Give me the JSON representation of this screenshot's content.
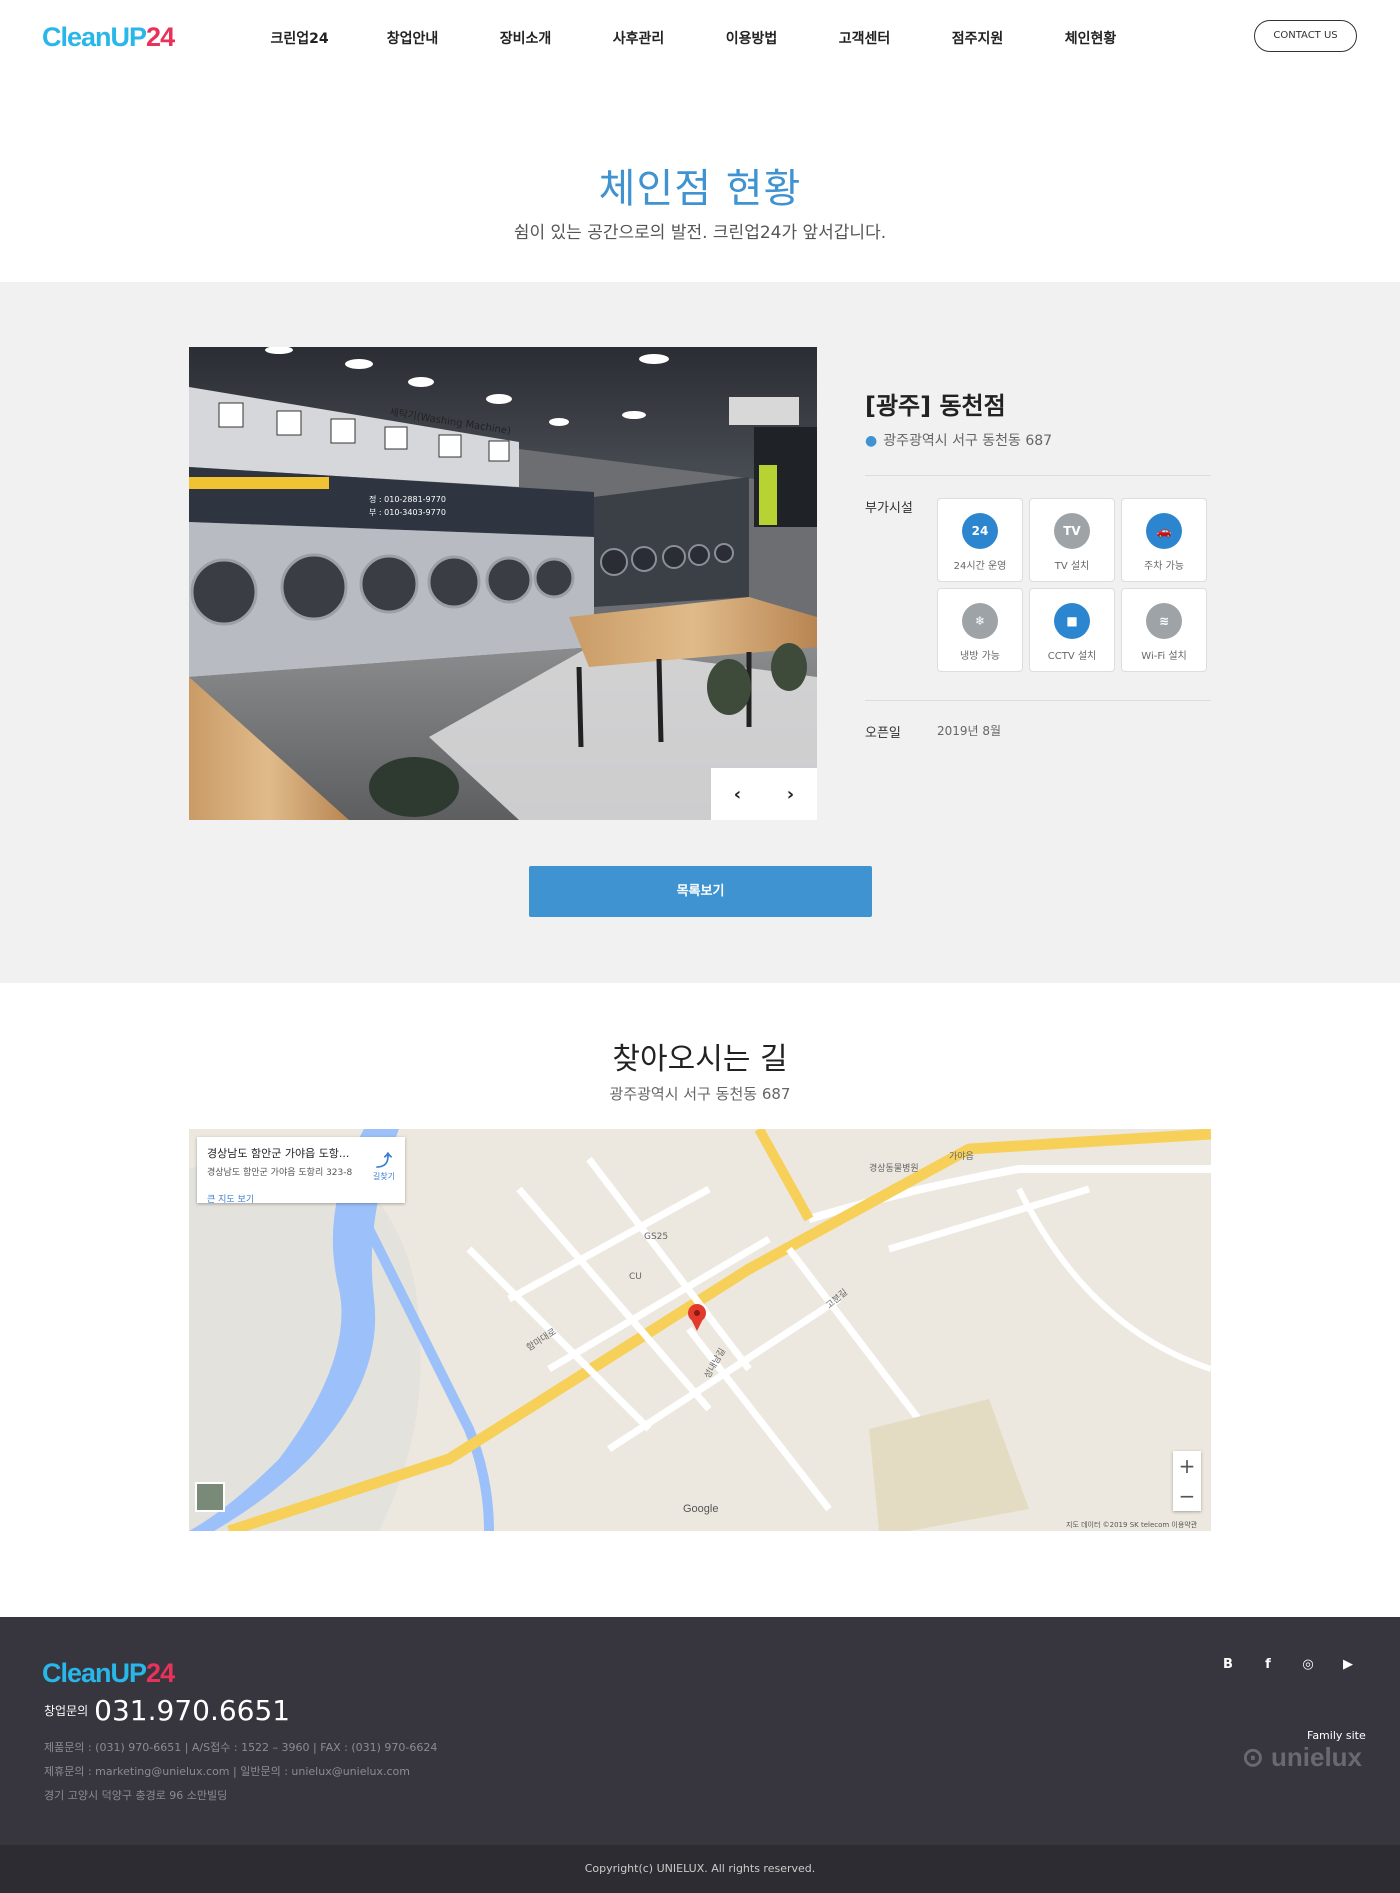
{
  "header": {
    "logo_part1": "CleanUP",
    "logo_part2": "24",
    "nav": [
      "크린업24",
      "창업안내",
      "장비소개",
      "사후관리",
      "이용방법",
      "고객센터",
      "점주지원",
      "체인현황"
    ],
    "contact_label": "CONTACT US"
  },
  "hero": {
    "title": "체인점 현황",
    "subtitle": "쉼이 있는 공간으로의 발전. 크린업24가 앞서갑니다."
  },
  "store": {
    "name": "[광주] 동천점",
    "address": "광주광역시 서구 동천동 687",
    "facilities_label": "부가시설",
    "facilities": [
      {
        "label": "24시간 운영",
        "icon": "clock-24-icon",
        "active": true,
        "glyph": "24"
      },
      {
        "label": "TV 설치",
        "icon": "tv-icon",
        "active": false,
        "glyph": "TV"
      },
      {
        "label": "주차 가능",
        "icon": "car-icon",
        "active": true,
        "glyph": "🚗"
      },
      {
        "label": "냉방 가능",
        "icon": "snowflake-icon",
        "active": false,
        "glyph": "❄"
      },
      {
        "label": "CCTV 설치",
        "icon": "video-camera-icon",
        "active": true,
        "glyph": "■"
      },
      {
        "label": "Wi-Fi 설치",
        "icon": "wifi-icon",
        "active": false,
        "glyph": "≋"
      }
    ],
    "open_label": "오픈일",
    "open_value": "2019년 8월",
    "prev_arrow": "‹",
    "next_arrow": "›",
    "photo_sign": "세탁기(Washing Machine)",
    "photo_phone1": "정 : 010-2881-9770",
    "photo_phone2": "부 : 010-3403-9770"
  },
  "list_button": "목록보기",
  "directions": {
    "title": "찾아오시는 길",
    "address": "광주광역시 서구 동천동 687",
    "map_card_title": "경상남도 함안군 가야읍 도항...",
    "map_card_sub": "경상남도 함안군 가야읍 도항리 323-8",
    "map_card_link": "큰 지도 보기",
    "map_card_dir": "길찾기",
    "google": "Google",
    "credit": "지도 데이터 ©2019 SK telecom   이용약관",
    "zoom_in": "+",
    "zoom_out": "−",
    "map_labels": [
      "함마대로",
      "성내남길",
      "고분길",
      "GS25",
      "CU",
      "가야읍",
      "경상동물병원"
    ]
  },
  "footer": {
    "logo_part1": "CleanUP",
    "logo_part2": "24",
    "phone_label": "창업문의",
    "phone": "031.970.6651",
    "line1": "제품문의 : (031) 970-6651  |  A/S접수 : 1522 – 3960  |  FAX : (031) 970-6624",
    "line2": "제휴문의 : marketing@unielux.com  |  일반문의 : unielux@unielux.com",
    "line3": "경기 고양시 덕양구 충경로 96 소만빌딩",
    "social": [
      "B",
      "f",
      "◎",
      "▶"
    ],
    "family_label": "Family site",
    "family_brand": "⊙ unielux",
    "copyright": "Copyright(c) UNIELUX. All rights reserved."
  },
  "colors": {
    "accent": "#3f93d1",
    "logo_cyan": "#29b6e8",
    "logo_pink": "#e8325a",
    "footer_bg": "#37363e",
    "icon_active": "#2c86cf",
    "icon_inactive": "#9ea3a8"
  }
}
